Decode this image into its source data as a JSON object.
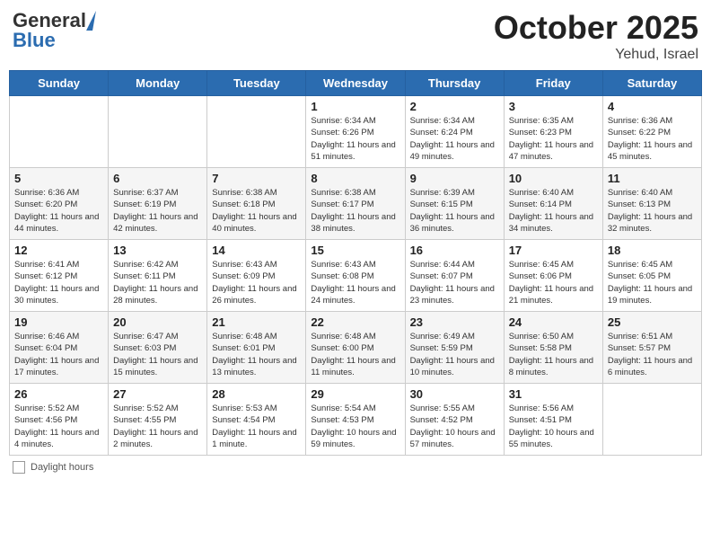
{
  "header": {
    "logo_general": "General",
    "logo_blue": "Blue",
    "month": "October 2025",
    "location": "Yehud, Israel"
  },
  "weekdays": [
    "Sunday",
    "Monday",
    "Tuesday",
    "Wednesday",
    "Thursday",
    "Friday",
    "Saturday"
  ],
  "footer": {
    "label": "Daylight hours"
  },
  "days": [
    {
      "date": "",
      "sunrise": "",
      "sunset": "",
      "daylight": ""
    },
    {
      "date": "",
      "sunrise": "",
      "sunset": "",
      "daylight": ""
    },
    {
      "date": "",
      "sunrise": "",
      "sunset": "",
      "daylight": ""
    },
    {
      "date": "1",
      "sunrise": "Sunrise: 6:34 AM",
      "sunset": "Sunset: 6:26 PM",
      "daylight": "Daylight: 11 hours and 51 minutes."
    },
    {
      "date": "2",
      "sunrise": "Sunrise: 6:34 AM",
      "sunset": "Sunset: 6:24 PM",
      "daylight": "Daylight: 11 hours and 49 minutes."
    },
    {
      "date": "3",
      "sunrise": "Sunrise: 6:35 AM",
      "sunset": "Sunset: 6:23 PM",
      "daylight": "Daylight: 11 hours and 47 minutes."
    },
    {
      "date": "4",
      "sunrise": "Sunrise: 6:36 AM",
      "sunset": "Sunset: 6:22 PM",
      "daylight": "Daylight: 11 hours and 45 minutes."
    },
    {
      "date": "5",
      "sunrise": "Sunrise: 6:36 AM",
      "sunset": "Sunset: 6:20 PM",
      "daylight": "Daylight: 11 hours and 44 minutes."
    },
    {
      "date": "6",
      "sunrise": "Sunrise: 6:37 AM",
      "sunset": "Sunset: 6:19 PM",
      "daylight": "Daylight: 11 hours and 42 minutes."
    },
    {
      "date": "7",
      "sunrise": "Sunrise: 6:38 AM",
      "sunset": "Sunset: 6:18 PM",
      "daylight": "Daylight: 11 hours and 40 minutes."
    },
    {
      "date": "8",
      "sunrise": "Sunrise: 6:38 AM",
      "sunset": "Sunset: 6:17 PM",
      "daylight": "Daylight: 11 hours and 38 minutes."
    },
    {
      "date": "9",
      "sunrise": "Sunrise: 6:39 AM",
      "sunset": "Sunset: 6:15 PM",
      "daylight": "Daylight: 11 hours and 36 minutes."
    },
    {
      "date": "10",
      "sunrise": "Sunrise: 6:40 AM",
      "sunset": "Sunset: 6:14 PM",
      "daylight": "Daylight: 11 hours and 34 minutes."
    },
    {
      "date": "11",
      "sunrise": "Sunrise: 6:40 AM",
      "sunset": "Sunset: 6:13 PM",
      "daylight": "Daylight: 11 hours and 32 minutes."
    },
    {
      "date": "12",
      "sunrise": "Sunrise: 6:41 AM",
      "sunset": "Sunset: 6:12 PM",
      "daylight": "Daylight: 11 hours and 30 minutes."
    },
    {
      "date": "13",
      "sunrise": "Sunrise: 6:42 AM",
      "sunset": "Sunset: 6:11 PM",
      "daylight": "Daylight: 11 hours and 28 minutes."
    },
    {
      "date": "14",
      "sunrise": "Sunrise: 6:43 AM",
      "sunset": "Sunset: 6:09 PM",
      "daylight": "Daylight: 11 hours and 26 minutes."
    },
    {
      "date": "15",
      "sunrise": "Sunrise: 6:43 AM",
      "sunset": "Sunset: 6:08 PM",
      "daylight": "Daylight: 11 hours and 24 minutes."
    },
    {
      "date": "16",
      "sunrise": "Sunrise: 6:44 AM",
      "sunset": "Sunset: 6:07 PM",
      "daylight": "Daylight: 11 hours and 23 minutes."
    },
    {
      "date": "17",
      "sunrise": "Sunrise: 6:45 AM",
      "sunset": "Sunset: 6:06 PM",
      "daylight": "Daylight: 11 hours and 21 minutes."
    },
    {
      "date": "18",
      "sunrise": "Sunrise: 6:45 AM",
      "sunset": "Sunset: 6:05 PM",
      "daylight": "Daylight: 11 hours and 19 minutes."
    },
    {
      "date": "19",
      "sunrise": "Sunrise: 6:46 AM",
      "sunset": "Sunset: 6:04 PM",
      "daylight": "Daylight: 11 hours and 17 minutes."
    },
    {
      "date": "20",
      "sunrise": "Sunrise: 6:47 AM",
      "sunset": "Sunset: 6:03 PM",
      "daylight": "Daylight: 11 hours and 15 minutes."
    },
    {
      "date": "21",
      "sunrise": "Sunrise: 6:48 AM",
      "sunset": "Sunset: 6:01 PM",
      "daylight": "Daylight: 11 hours and 13 minutes."
    },
    {
      "date": "22",
      "sunrise": "Sunrise: 6:48 AM",
      "sunset": "Sunset: 6:00 PM",
      "daylight": "Daylight: 11 hours and 11 minutes."
    },
    {
      "date": "23",
      "sunrise": "Sunrise: 6:49 AM",
      "sunset": "Sunset: 5:59 PM",
      "daylight": "Daylight: 11 hours and 10 minutes."
    },
    {
      "date": "24",
      "sunrise": "Sunrise: 6:50 AM",
      "sunset": "Sunset: 5:58 PM",
      "daylight": "Daylight: 11 hours and 8 minutes."
    },
    {
      "date": "25",
      "sunrise": "Sunrise: 6:51 AM",
      "sunset": "Sunset: 5:57 PM",
      "daylight": "Daylight: 11 hours and 6 minutes."
    },
    {
      "date": "26",
      "sunrise": "Sunrise: 5:52 AM",
      "sunset": "Sunset: 4:56 PM",
      "daylight": "Daylight: 11 hours and 4 minutes."
    },
    {
      "date": "27",
      "sunrise": "Sunrise: 5:52 AM",
      "sunset": "Sunset: 4:55 PM",
      "daylight": "Daylight: 11 hours and 2 minutes."
    },
    {
      "date": "28",
      "sunrise": "Sunrise: 5:53 AM",
      "sunset": "Sunset: 4:54 PM",
      "daylight": "Daylight: 11 hours and 1 minute."
    },
    {
      "date": "29",
      "sunrise": "Sunrise: 5:54 AM",
      "sunset": "Sunset: 4:53 PM",
      "daylight": "Daylight: 10 hours and 59 minutes."
    },
    {
      "date": "30",
      "sunrise": "Sunrise: 5:55 AM",
      "sunset": "Sunset: 4:52 PM",
      "daylight": "Daylight: 10 hours and 57 minutes."
    },
    {
      "date": "31",
      "sunrise": "Sunrise: 5:56 AM",
      "sunset": "Sunset: 4:51 PM",
      "daylight": "Daylight: 10 hours and 55 minutes."
    },
    {
      "date": "",
      "sunrise": "",
      "sunset": "",
      "daylight": ""
    }
  ]
}
